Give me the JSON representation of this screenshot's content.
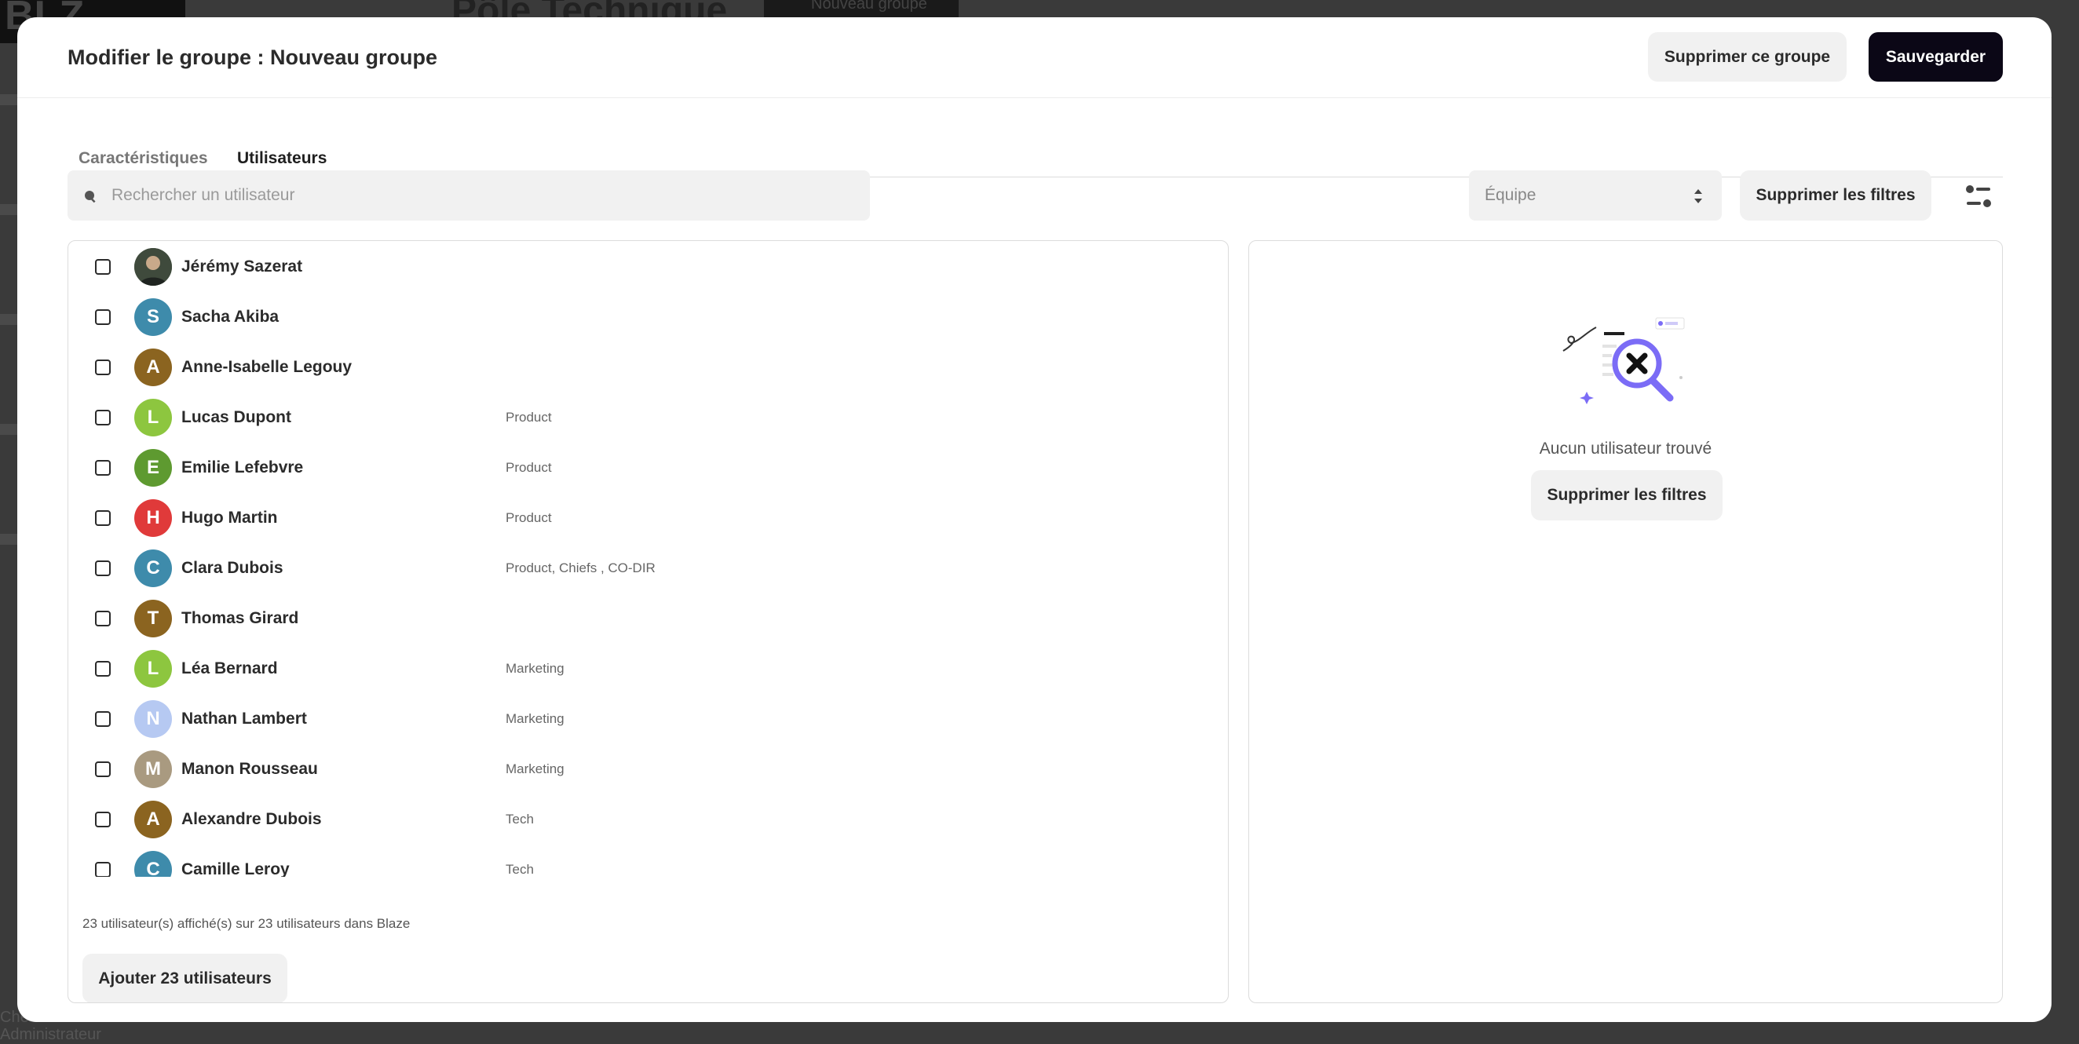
{
  "modal": {
    "title": "Modifier le groupe : Nouveau groupe",
    "delete_group_label": "Supprimer ce groupe",
    "save_label": "Sauvegarder"
  },
  "tabs": [
    {
      "label": "Caractéristiques",
      "active": false
    },
    {
      "label": "Utilisateurs",
      "active": true
    }
  ],
  "toolbar": {
    "search_placeholder": "Rechercher un utilisateur",
    "team_select_value": "Équipe",
    "clear_filters_label": "Supprimer les filtres"
  },
  "users": [
    {
      "name": "Jérémy Sazerat",
      "initial": "",
      "team": "",
      "color": "#556b52",
      "photo": true
    },
    {
      "name": "Sacha Akiba",
      "initial": "S",
      "team": "",
      "color": "#3e8bab"
    },
    {
      "name": "Anne-Isabelle Legouy",
      "initial": "A",
      "team": "",
      "color": "#8b6420"
    },
    {
      "name": "Lucas Dupont",
      "initial": "L",
      "team": "Product",
      "color": "#8dc63f"
    },
    {
      "name": "Emilie Lefebvre",
      "initial": "E",
      "team": "Product",
      "color": "#5e9a30"
    },
    {
      "name": "Hugo Martin",
      "initial": "H",
      "team": "Product",
      "color": "#e03a3a"
    },
    {
      "name": "Clara Dubois",
      "initial": "C",
      "team": "Product, Chiefs , CO-DIR",
      "color": "#3e8bab"
    },
    {
      "name": "Thomas Girard",
      "initial": "T",
      "team": "",
      "color": "#8b6420"
    },
    {
      "name": "Léa Bernard",
      "initial": "L",
      "team": "Marketing",
      "color": "#8dc63f"
    },
    {
      "name": "Nathan Lambert",
      "initial": "N",
      "team": "Marketing",
      "color": "#b6c9f2"
    },
    {
      "name": "Manon Rousseau",
      "initial": "M",
      "team": "Marketing",
      "color": "#a99a80"
    },
    {
      "name": "Alexandre Dubois",
      "initial": "A",
      "team": "Tech",
      "color": "#8b6420"
    },
    {
      "name": "Camille Leroy",
      "initial": "C",
      "team": "Tech",
      "color": "#3e8bab"
    }
  ],
  "list_footer": "23 utilisateur(s) affiché(s) sur 23 utilisateurs dans Blaze",
  "add_users_label": "Ajouter 23 utilisateurs",
  "empty_state": {
    "text": "Aucun utilisateur trouvé",
    "clear_filters_label": "Supprimer les filtres"
  },
  "background": {
    "title": "Pôle Technique",
    "button": "Nouveau groupe",
    "bottom_text_1": "Chef",
    "bottom_text_2": "Administrateur"
  },
  "colors": {
    "primary_dark": "#0b0716",
    "light_button": "#f1f1f1",
    "illustration_accent": "#7b6cf6"
  }
}
